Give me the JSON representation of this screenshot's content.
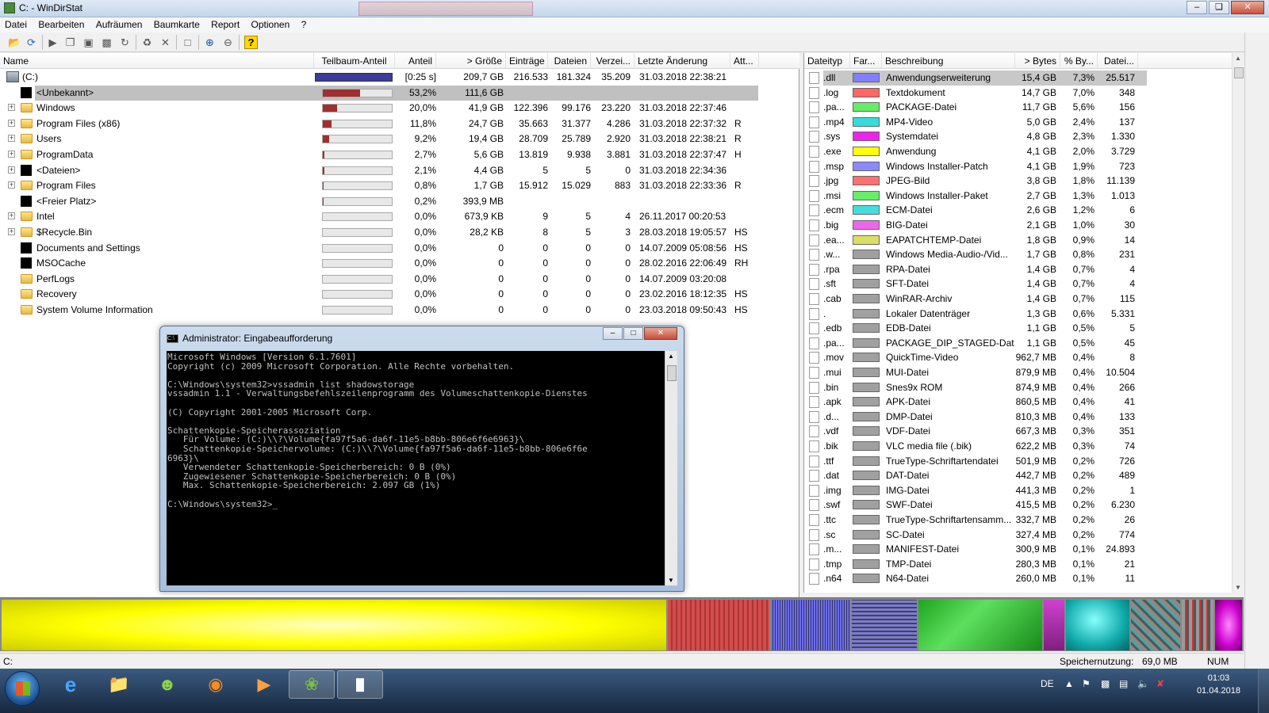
{
  "window": {
    "title": "C: - WinDirStat"
  },
  "menu": [
    "Datei",
    "Bearbeiten",
    "Aufräumen",
    "Baumkarte",
    "Report",
    "Optionen",
    "?"
  ],
  "toolbar_icons": [
    "open-icon",
    "refresh-icon",
    "play-icon",
    "copy-icon",
    "explorer-icon",
    "cmd-icon",
    "refresh-selected-icon",
    "recycle-icon",
    "delete-icon",
    "properties-icon",
    "zoom-in-icon",
    "zoom-out-icon",
    "help-icon"
  ],
  "tree": {
    "headers": [
      "Name",
      "Teilbaum-Anteil",
      "Anteil",
      "> Größe",
      "Einträge",
      "Dateien",
      "Verzei...",
      "Letzte Änderung",
      "Att..."
    ],
    "rows": [
      {
        "name": "(C:)",
        "icon": "drive-icon",
        "share": 1.0,
        "pct": "[0:25 s]",
        "size": "209,7 GB",
        "entries": "216.533",
        "files": "181.324",
        "dirs": "35.209",
        "changed": "31.03.2018  22:38:21",
        "attr": "",
        "expand": false,
        "indent": 0
      },
      {
        "name": "<Unbekannt>",
        "icon": "black-square-icon",
        "share": 0.532,
        "pct": "53,2%",
        "size": "111,6 GB",
        "entries": "",
        "files": "",
        "dirs": "",
        "changed": "",
        "attr": "",
        "expand": false,
        "indent": 1,
        "selected": true
      },
      {
        "name": "Windows",
        "icon": "folder-icon",
        "share": 0.2,
        "pct": "20,0%",
        "size": "41,9 GB",
        "entries": "122.396",
        "files": "99.176",
        "dirs": "23.220",
        "changed": "31.03.2018  22:37:46",
        "attr": "",
        "expand": true,
        "indent": 1
      },
      {
        "name": "Program Files (x86)",
        "icon": "folder-icon",
        "share": 0.118,
        "pct": "11,8%",
        "size": "24,7 GB",
        "entries": "35.663",
        "files": "31.377",
        "dirs": "4.286",
        "changed": "31.03.2018  22:37:32",
        "attr": "R",
        "expand": true,
        "indent": 1
      },
      {
        "name": "Users",
        "icon": "folder-icon",
        "share": 0.092,
        "pct": "9,2%",
        "size": "19,4 GB",
        "entries": "28.709",
        "files": "25.789",
        "dirs": "2.920",
        "changed": "31.03.2018  22:38:21",
        "attr": "R",
        "expand": true,
        "indent": 1
      },
      {
        "name": "ProgramData",
        "icon": "folder-icon",
        "share": 0.027,
        "pct": "2,7%",
        "size": "5,6 GB",
        "entries": "13.819",
        "files": "9.938",
        "dirs": "3.881",
        "changed": "31.03.2018  22:37:47",
        "attr": "H",
        "expand": true,
        "indent": 1
      },
      {
        "name": "<Dateien>",
        "icon": "black-square-icon",
        "share": 0.021,
        "pct": "2,1%",
        "size": "4,4 GB",
        "entries": "5",
        "files": "5",
        "dirs": "0",
        "changed": "31.03.2018  22:34:36",
        "attr": "",
        "expand": true,
        "indent": 1
      },
      {
        "name": "Program Files",
        "icon": "folder-icon",
        "share": 0.008,
        "pct": "0,8%",
        "size": "1,7 GB",
        "entries": "15.912",
        "files": "15.029",
        "dirs": "883",
        "changed": "31.03.2018  22:33:36",
        "attr": "R",
        "expand": true,
        "indent": 1
      },
      {
        "name": "<Freier Platz>",
        "icon": "black-square-icon",
        "share": 0.002,
        "pct": "0,2%",
        "size": "393,9 MB",
        "entries": "",
        "files": "",
        "dirs": "",
        "changed": "",
        "attr": "",
        "expand": false,
        "indent": 1
      },
      {
        "name": "Intel",
        "icon": "folder-icon",
        "share": 0.0,
        "pct": "0,0%",
        "size": "673,9 KB",
        "entries": "9",
        "files": "5",
        "dirs": "4",
        "changed": "26.11.2017  00:20:53",
        "attr": "",
        "expand": true,
        "indent": 1
      },
      {
        "name": "$Recycle.Bin",
        "icon": "folder-icon",
        "share": 0.0,
        "pct": "0,0%",
        "size": "28,2 KB",
        "entries": "8",
        "files": "5",
        "dirs": "3",
        "changed": "28.03.2018  19:05:57",
        "attr": "HS",
        "expand": true,
        "indent": 1
      },
      {
        "name": "Documents and Settings",
        "icon": "black-square-icon",
        "share": 0.0,
        "pct": "0,0%",
        "size": "0",
        "entries": "0",
        "files": "0",
        "dirs": "0",
        "changed": "14.07.2009  05:08:56",
        "attr": "HS",
        "expand": false,
        "indent": 1
      },
      {
        "name": "MSOCache",
        "icon": "black-square-icon",
        "share": 0.0,
        "pct": "0,0%",
        "size": "0",
        "entries": "0",
        "files": "0",
        "dirs": "0",
        "changed": "28.02.2016  22:06:49",
        "attr": "RH",
        "expand": false,
        "indent": 1
      },
      {
        "name": "PerfLogs",
        "icon": "folder-icon",
        "share": 0.0,
        "pct": "0,0%",
        "size": "0",
        "entries": "0",
        "files": "0",
        "dirs": "0",
        "changed": "14.07.2009  03:20:08",
        "attr": "",
        "expand": false,
        "indent": 1
      },
      {
        "name": "Recovery",
        "icon": "folder-icon",
        "share": 0.0,
        "pct": "0,0%",
        "size": "0",
        "entries": "0",
        "files": "0",
        "dirs": "0",
        "changed": "23.02.2016  18:12:35",
        "attr": "HS",
        "expand": false,
        "indent": 1
      },
      {
        "name": "System Volume Information",
        "icon": "folder-icon",
        "share": 0.0,
        "pct": "0,0%",
        "size": "0",
        "entries": "0",
        "files": "0",
        "dirs": "0",
        "changed": "23.03.2018  09:50:43",
        "attr": "HS",
        "expand": false,
        "indent": 1
      }
    ]
  },
  "types": {
    "headers": [
      "Dateityp",
      "Far...",
      "Beschreibung",
      "> Bytes",
      "% By...",
      "Datei..."
    ],
    "rows": [
      {
        "ext": ".dll",
        "color": "#8080ff",
        "desc": "Anwendungserweiterung",
        "bytes": "15,4 GB",
        "pct": "7,3%",
        "files": "25.517",
        "selected": true
      },
      {
        "ext": ".log",
        "color": "#ff6666",
        "desc": "Textdokument",
        "bytes": "14,7 GB",
        "pct": "7,0%",
        "files": "348"
      },
      {
        "ext": ".pa...",
        "color": "#66ee66",
        "desc": "PACKAGE-Datei",
        "bytes": "11,7 GB",
        "pct": "5,6%",
        "files": "156"
      },
      {
        "ext": ".mp4",
        "color": "#33dddd",
        "desc": "MP4-Video",
        "bytes": "5,0 GB",
        "pct": "2,4%",
        "files": "137"
      },
      {
        "ext": ".sys",
        "color": "#ee22ee",
        "desc": "Systemdatei",
        "bytes": "4,8 GB",
        "pct": "2,3%",
        "files": "1.330"
      },
      {
        "ext": ".exe",
        "color": "#ffff00",
        "desc": "Anwendung",
        "bytes": "4,1 GB",
        "pct": "2,0%",
        "files": "3.729"
      },
      {
        "ext": ".msp",
        "color": "#8a8aff",
        "desc": "Windows Installer-Patch",
        "bytes": "4,1 GB",
        "pct": "1,9%",
        "files": "723"
      },
      {
        "ext": ".jpg",
        "color": "#ff7070",
        "desc": "JPEG-Bild",
        "bytes": "3,8 GB",
        "pct": "1,8%",
        "files": "11.139"
      },
      {
        "ext": ".msi",
        "color": "#66ee66",
        "desc": "Windows Installer-Paket",
        "bytes": "2,7 GB",
        "pct": "1,3%",
        "files": "1.013"
      },
      {
        "ext": ".ecm",
        "color": "#44dddd",
        "desc": "ECM-Datei",
        "bytes": "2,6 GB",
        "pct": "1,2%",
        "files": "6"
      },
      {
        "ext": ".big",
        "color": "#ee66ee",
        "desc": "BIG-Datei",
        "bytes": "2,1 GB",
        "pct": "1,0%",
        "files": "30"
      },
      {
        "ext": ".ea...",
        "color": "#dddd66",
        "desc": "EAPATCHTEMP-Datei",
        "bytes": "1,8 GB",
        "pct": "0,9%",
        "files": "14"
      },
      {
        "ext": ".w...",
        "color": "#a0a0a0",
        "desc": "Windows Media-Audio-/Vid...",
        "bytes": "1,7 GB",
        "pct": "0,8%",
        "files": "231"
      },
      {
        "ext": ".rpa",
        "color": "#a0a0a0",
        "desc": "RPA-Datei",
        "bytes": "1,4 GB",
        "pct": "0,7%",
        "files": "4"
      },
      {
        "ext": ".sft",
        "color": "#a0a0a0",
        "desc": "SFT-Datei",
        "bytes": "1,4 GB",
        "pct": "0,7%",
        "files": "4"
      },
      {
        "ext": ".cab",
        "color": "#a0a0a0",
        "desc": "WinRAR-Archiv",
        "bytes": "1,4 GB",
        "pct": "0,7%",
        "files": "115"
      },
      {
        "ext": ".",
        "color": "#a0a0a0",
        "desc": "Lokaler Datenträger",
        "bytes": "1,3 GB",
        "pct": "0,6%",
        "files": "5.331"
      },
      {
        "ext": ".edb",
        "color": "#a0a0a0",
        "desc": "EDB-Datei",
        "bytes": "1,1 GB",
        "pct": "0,5%",
        "files": "5"
      },
      {
        "ext": ".pa...",
        "color": "#a0a0a0",
        "desc": "PACKAGE_DIP_STAGED-Datei",
        "bytes": "1,1 GB",
        "pct": "0,5%",
        "files": "45"
      },
      {
        "ext": ".mov",
        "color": "#a0a0a0",
        "desc": "QuickTime-Video",
        "bytes": "962,7 MB",
        "pct": "0,4%",
        "files": "8"
      },
      {
        "ext": ".mui",
        "color": "#a0a0a0",
        "desc": "MUI-Datei",
        "bytes": "879,9 MB",
        "pct": "0,4%",
        "files": "10.504"
      },
      {
        "ext": ".bin",
        "color": "#a0a0a0",
        "desc": "Snes9x ROM",
        "bytes": "874,9 MB",
        "pct": "0,4%",
        "files": "266"
      },
      {
        "ext": ".apk",
        "color": "#a0a0a0",
        "desc": "APK-Datei",
        "bytes": "860,5 MB",
        "pct": "0,4%",
        "files": "41"
      },
      {
        "ext": ".d...",
        "color": "#a0a0a0",
        "desc": "DMP-Datei",
        "bytes": "810,3 MB",
        "pct": "0,4%",
        "files": "133"
      },
      {
        "ext": ".vdf",
        "color": "#a0a0a0",
        "desc": "VDF-Datei",
        "bytes": "667,3 MB",
        "pct": "0,3%",
        "files": "351"
      },
      {
        "ext": ".bik",
        "color": "#a0a0a0",
        "desc": "VLC media file (.bik)",
        "bytes": "622,2 MB",
        "pct": "0,3%",
        "files": "74"
      },
      {
        "ext": ".ttf",
        "color": "#a0a0a0",
        "desc": "TrueType-Schriftartendatei",
        "bytes": "501,9 MB",
        "pct": "0,2%",
        "files": "726"
      },
      {
        "ext": ".dat",
        "color": "#a0a0a0",
        "desc": "DAT-Datei",
        "bytes": "442,7 MB",
        "pct": "0,2%",
        "files": "489"
      },
      {
        "ext": ".img",
        "color": "#a0a0a0",
        "desc": "IMG-Datei",
        "bytes": "441,3 MB",
        "pct": "0,2%",
        "files": "1"
      },
      {
        "ext": ".swf",
        "color": "#a0a0a0",
        "desc": "SWF-Datei",
        "bytes": "415,5 MB",
        "pct": "0,2%",
        "files": "6.230"
      },
      {
        "ext": ".ttc",
        "color": "#a0a0a0",
        "desc": "TrueType-Schriftartensamm...",
        "bytes": "332,7 MB",
        "pct": "0,2%",
        "files": "26"
      },
      {
        "ext": ".sc",
        "color": "#a0a0a0",
        "desc": "SC-Datei",
        "bytes": "327,4 MB",
        "pct": "0,2%",
        "files": "774"
      },
      {
        "ext": ".m...",
        "color": "#a0a0a0",
        "desc": "MANIFEST-Datei",
        "bytes": "300,9 MB",
        "pct": "0,1%",
        "files": "24.893"
      },
      {
        "ext": ".tmp",
        "color": "#a0a0a0",
        "desc": "TMP-Datei",
        "bytes": "280,3 MB",
        "pct": "0,1%",
        "files": "21"
      },
      {
        "ext": ".n64",
        "color": "#a0a0a0",
        "desc": "N64-Datei",
        "bytes": "260,0 MB",
        "pct": "0,1%",
        "files": "11"
      }
    ]
  },
  "cmd": {
    "title": "Administrator: Eingabeaufforderung",
    "lines": [
      "Microsoft Windows [Version 6.1.7601]",
      "Copyright (c) 2009 Microsoft Corporation. Alle Rechte vorbehalten.",
      "",
      "C:\\Windows\\system32>vssadmin list shadowstorage",
      "vssadmin 1.1 - Verwaltungsbefehlszeilenprogramm des Volumeschattenkopie-Dienstes",
      "",
      "(C) Copyright 2001-2005 Microsoft Corp.",
      "",
      "Schattenkopie-Speicherassoziation",
      "   Für Volume: (C:)\\\\?\\Volume{fa97f5a6-da6f-11e5-b8bb-806e6f6e6963}\\",
      "   Schattenkopie-Speichervolume: (C:)\\\\?\\Volume{fa97f5a6-da6f-11e5-b8bb-806e6f6e",
      "6963}\\",
      "   Verwendeter Schattenkopie-Speicherbereich: 0 B (0%)",
      "   Zugewiesener Schattenkopie-Speicherbereich: 0 B (0%)",
      "   Max. Schattenkopie-Speicherbereich: 2.097 GB (1%)",
      "",
      "C:\\Windows\\system32>_"
    ]
  },
  "status": {
    "path": "C:",
    "memory_label": "Speichernutzung:",
    "memory_value": "69,0 MB",
    "num": "NUM"
  },
  "taskbar": {
    "apps": [
      "ie-icon",
      "explorer-icon",
      "network-icon",
      "firefox-icon",
      "media-player-icon",
      "windirstat-icon",
      "cmd-icon"
    ],
    "lang": "DE",
    "time": "01:03",
    "date": "01.04.2018"
  },
  "colors": {
    "treemap_exe": "#ffff00",
    "selection": "#c0c0c0",
    "subtree_bar": "#a03030"
  }
}
